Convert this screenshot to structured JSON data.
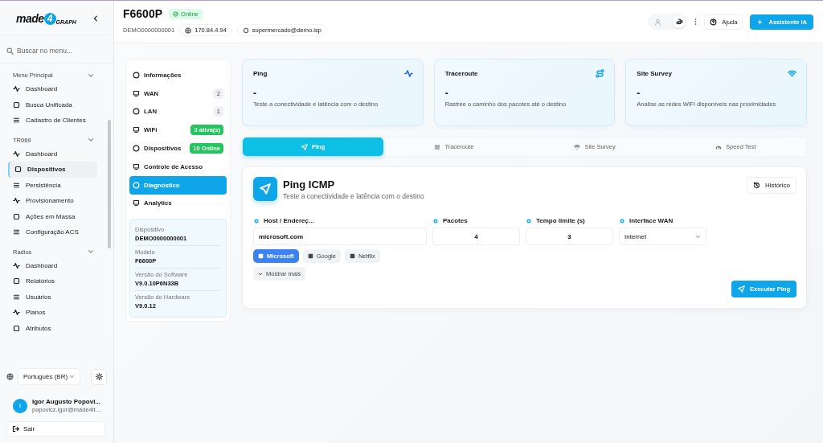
{
  "sidebar": {
    "logo": {
      "before": "made",
      "mark": "4",
      "after": "GRAPH"
    },
    "search": {
      "placeholder": "Buscar no menu..."
    },
    "sections": [
      {
        "title": "Menu Principal",
        "expanded": true,
        "items": [
          {
            "label": "Dashboard",
            "selected": false
          },
          {
            "label": "Busca Unificada",
            "selected": false
          },
          {
            "label": "Cadastro de Clientes",
            "selected": false
          }
        ]
      },
      {
        "title": "TR069",
        "expanded": true,
        "items": [
          {
            "label": "Dashboard",
            "selected": false
          },
          {
            "label": "Dispositivos",
            "selected": true
          },
          {
            "label": "Persistência",
            "selected": false
          },
          {
            "label": "Provisionamento",
            "selected": false
          },
          {
            "label": "Ações em Massa",
            "selected": false
          },
          {
            "label": "Configuração ACS",
            "selected": false
          }
        ]
      },
      {
        "title": "Radius",
        "expanded": true,
        "items": [
          {
            "label": "Dashboard",
            "selected": false
          },
          {
            "label": "Relatórios",
            "selected": false
          },
          {
            "label": "Usuários",
            "selected": false
          },
          {
            "label": "Planos",
            "selected": false
          },
          {
            "label": "Atributos",
            "selected": false
          }
        ]
      }
    ],
    "language": "Português (BR)",
    "user": {
      "initial": "I",
      "name": "Igor Augusto Popovi...",
      "email": "popovicz.igor@made4it...."
    },
    "logout": "Sair"
  },
  "header": {
    "title": "F6600P",
    "status": {
      "label": "Online",
      "online": true
    },
    "serial": "DEMO0000000001",
    "ip": "170.84.4.94",
    "account": "supermercado@demo.isp",
    "help": "Ajuda",
    "assistant": "Assistente IA"
  },
  "device_nav": {
    "items": [
      {
        "label": "Informações",
        "selected": false
      },
      {
        "label": "WAN",
        "selected": false,
        "badge": {
          "text": "2",
          "kind": "count"
        }
      },
      {
        "label": "LAN",
        "selected": false,
        "badge": {
          "text": "1",
          "kind": "count"
        }
      },
      {
        "label": "WiFi",
        "selected": false,
        "badge": {
          "text": "3 ativa(s)",
          "kind": "status"
        }
      },
      {
        "label": "Dispositivos",
        "selected": false,
        "badge": {
          "text": "10 Online",
          "kind": "status"
        }
      },
      {
        "label": "Controle de Acesso",
        "selected": false
      },
      {
        "label": "Diagnóstico",
        "selected": true
      },
      {
        "label": "Analytics",
        "selected": false
      }
    ],
    "info": [
      {
        "label": "Dispositivo",
        "value": "DEMO0000000001"
      },
      {
        "label": "Modelo",
        "value": "F6600P"
      },
      {
        "label": "Versão do Software",
        "value": "V9.0.10P6N33B"
      },
      {
        "label": "Versão do Hardware",
        "value": "V9.0.12"
      }
    ]
  },
  "summary_cards": [
    {
      "title": "Ping",
      "value": "-",
      "description": "Teste a conectividade e latência com o destino"
    },
    {
      "title": "Traceroute",
      "value": "-",
      "description": "Rastree o caminho dos pacotes até o destino"
    },
    {
      "title": "Site Survey",
      "value": "-",
      "description": "Analise as redes WiFi disponíveis nas proximidades"
    }
  ],
  "tabs": [
    {
      "label": "Ping",
      "selected": true
    },
    {
      "label": "Traceroute",
      "selected": false
    },
    {
      "label": "Site Survey",
      "selected": false
    },
    {
      "label": "Speed Test",
      "selected": false
    }
  ],
  "panel": {
    "title": "Ping ICMP",
    "subtitle": "Teste a conectividade e latência com o destino",
    "history": "Histórico",
    "fields": [
      {
        "label": "Host / Endereç...",
        "value": "microsoft.com",
        "kind": "text"
      },
      {
        "label": "Pacotes",
        "value": "4",
        "kind": "number"
      },
      {
        "label": "Tempo limite (s)",
        "value": "3",
        "kind": "number"
      },
      {
        "label": "Interface WAN",
        "value": "Internet",
        "kind": "select"
      }
    ],
    "presets": [
      {
        "label": "Microsoft",
        "selected": true
      },
      {
        "label": "Google",
        "selected": false
      },
      {
        "label": "Netflix",
        "selected": false
      }
    ],
    "more": "Mostrar mais",
    "run": "Executar Ping"
  }
}
